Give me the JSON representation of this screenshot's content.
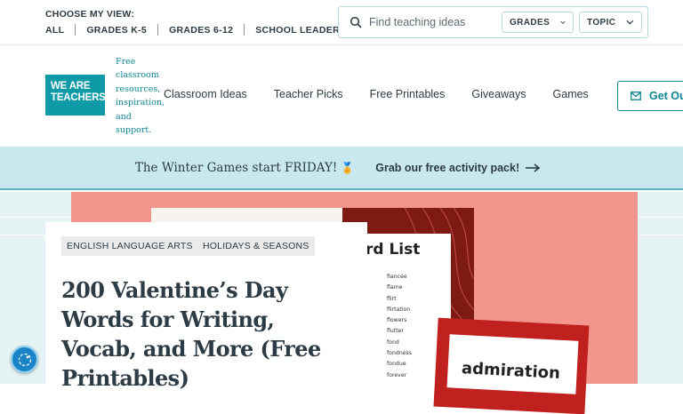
{
  "topbar": {
    "view_title": "CHOOSE MY VIEW:",
    "view_links": [
      "ALL",
      "GRADES K-5",
      "GRADES 6-12",
      "SCHOOL LEADERS"
    ],
    "search": {
      "placeholder": "Find teaching ideas"
    },
    "filters": {
      "grades": "GRADES",
      "topic": "TOPIC"
    }
  },
  "nav": {
    "logo_line1": "WE ARE",
    "logo_line2": "TEACHERS",
    "tagline": "Free classroom resources, inspiration, and support.",
    "links": [
      "Classroom Ideas",
      "Teacher Picks",
      "Free Printables",
      "Giveaways",
      "Games"
    ],
    "cta_label": "Get Ou"
  },
  "promo": {
    "text": "The Winter Games start FRIDAY!",
    "cta": "Grab our free activity pack!"
  },
  "hero": {
    "wordlist_title": "rd List",
    "words": [
      "fiancée",
      "flame",
      "flirt",
      "flirtation",
      "flowers",
      "flutter",
      "fond",
      "fondness",
      "fondue",
      "forever"
    ],
    "card_word": "admiration"
  },
  "article": {
    "tags": [
      "ENGLISH LANGUAGE ARTS",
      "HOLIDAYS & SEASONS"
    ],
    "title": "200 Valentine’s Day Words for Writing, Vocab, and More (Free Printables)"
  },
  "colors": {
    "brand_teal": "#0f9aa7",
    "promo_bg": "#c8e7ee",
    "hero_pink": "#f3948d",
    "dark_red": "#7e1a14",
    "card_red": "#c0211f"
  }
}
